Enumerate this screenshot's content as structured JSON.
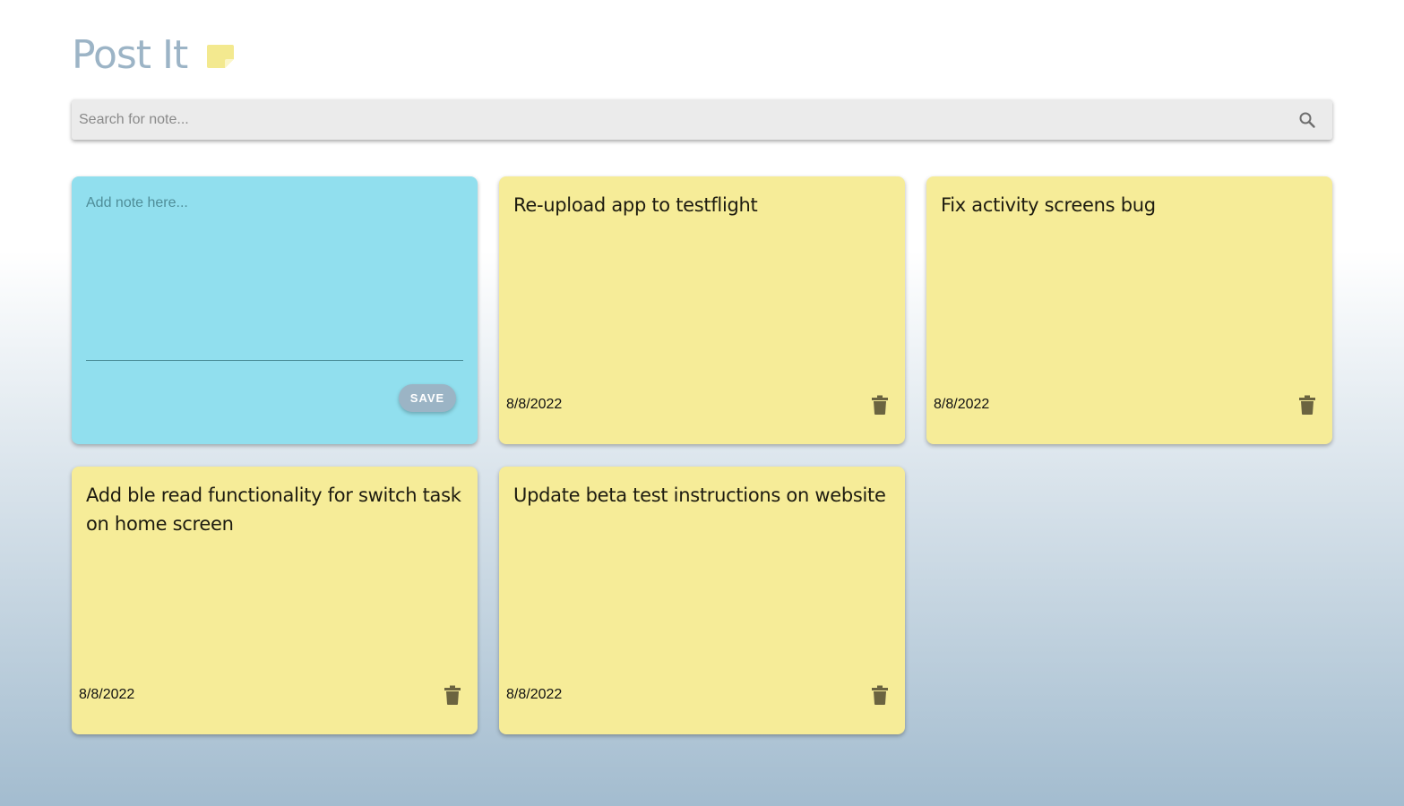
{
  "app": {
    "title": "Post It",
    "logo_icon": "sticky-note-icon"
  },
  "search": {
    "placeholder": "Search for note...",
    "value": "",
    "icon": "search-icon"
  },
  "add_note": {
    "placeholder": "Add note here...",
    "value": "",
    "save_label": "SAVE"
  },
  "notes": [
    {
      "text": "Re-upload app to testflight",
      "date": "8/8/2022"
    },
    {
      "text": "Fix activity screens bug",
      "date": "8/8/2022"
    },
    {
      "text": "Add ble read functionality for switch task on home screen",
      "date": "8/8/2022"
    },
    {
      "text": "Update beta test instructions on website",
      "date": "8/8/2022"
    }
  ],
  "colors": {
    "title": "#9cb4c6",
    "note_card": "#f6ec98",
    "add_card": "#91dfee",
    "save_button": "#9bb4c5",
    "logo": "#f3e98f",
    "delete_icon": "#6b6440",
    "search_bar": "#ebebeb"
  }
}
